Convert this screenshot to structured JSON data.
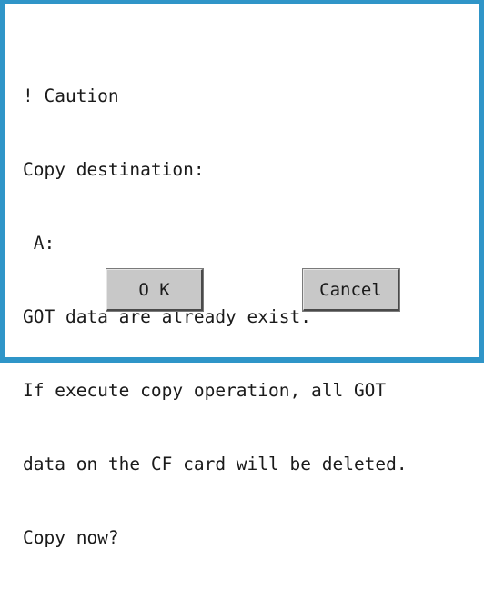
{
  "dialog": {
    "lines": [
      "! Caution",
      "Copy destination:",
      " A:",
      "GOT data are already exist.",
      "If execute copy operation, all GOT",
      "data on the CF card will be deleted.",
      "Copy now?"
    ]
  },
  "buttons": {
    "ok_label": "O K",
    "cancel_label": "Cancel"
  },
  "colors": {
    "frame": "#2f95c8",
    "button_face": "#c8c8c8"
  }
}
